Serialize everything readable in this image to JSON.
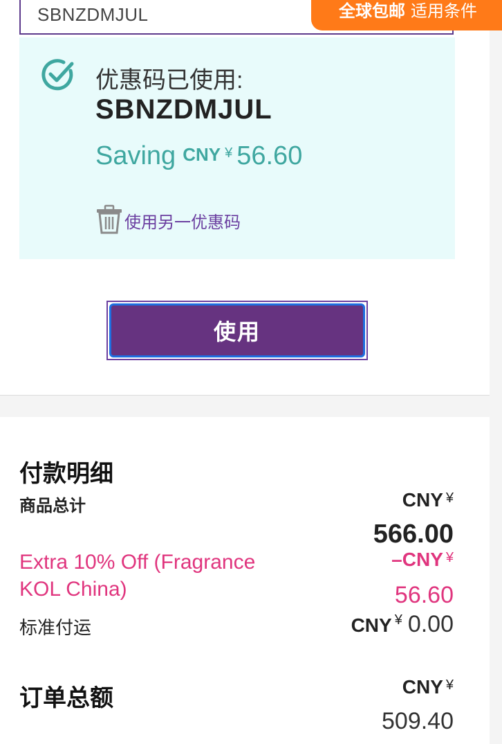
{
  "coupon_input": {
    "value": "SBNZDMJUL"
  },
  "promo_tab": {
    "bold": "全球包邮",
    "link": "适用条件"
  },
  "applied": {
    "label": "优惠码已使用:",
    "code": "SBNZDMJUL",
    "saving_label": "Saving",
    "saving_currency": "CNY",
    "saving_yen": "¥",
    "saving_amount": "56.60",
    "remove_label": "使用另一优惠码",
    "check_color": "#3fa7a0"
  },
  "apply_button": {
    "label": "使用"
  },
  "summary": {
    "title": "付款明细",
    "subtotal": {
      "label": "商品总计",
      "currency": "CNY",
      "yen": "¥",
      "value": "566.00"
    },
    "discount": {
      "label": "Extra 10% Off (Fragrance KOL China)",
      "sign": "–",
      "currency": "CNY",
      "yen": "¥",
      "value": "56.60"
    },
    "shipping": {
      "label": "标准付运",
      "currency": "CNY",
      "yen": "¥",
      "value": "0.00"
    },
    "total": {
      "label": "订单总额",
      "currency": "CNY",
      "yen": "¥",
      "value": "509.40"
    }
  },
  "colors": {
    "accent_purple": "#663380",
    "promo_orange": "#ff7a18",
    "discount_pink": "#e0357e",
    "applied_bg": "#e8fbfb"
  }
}
